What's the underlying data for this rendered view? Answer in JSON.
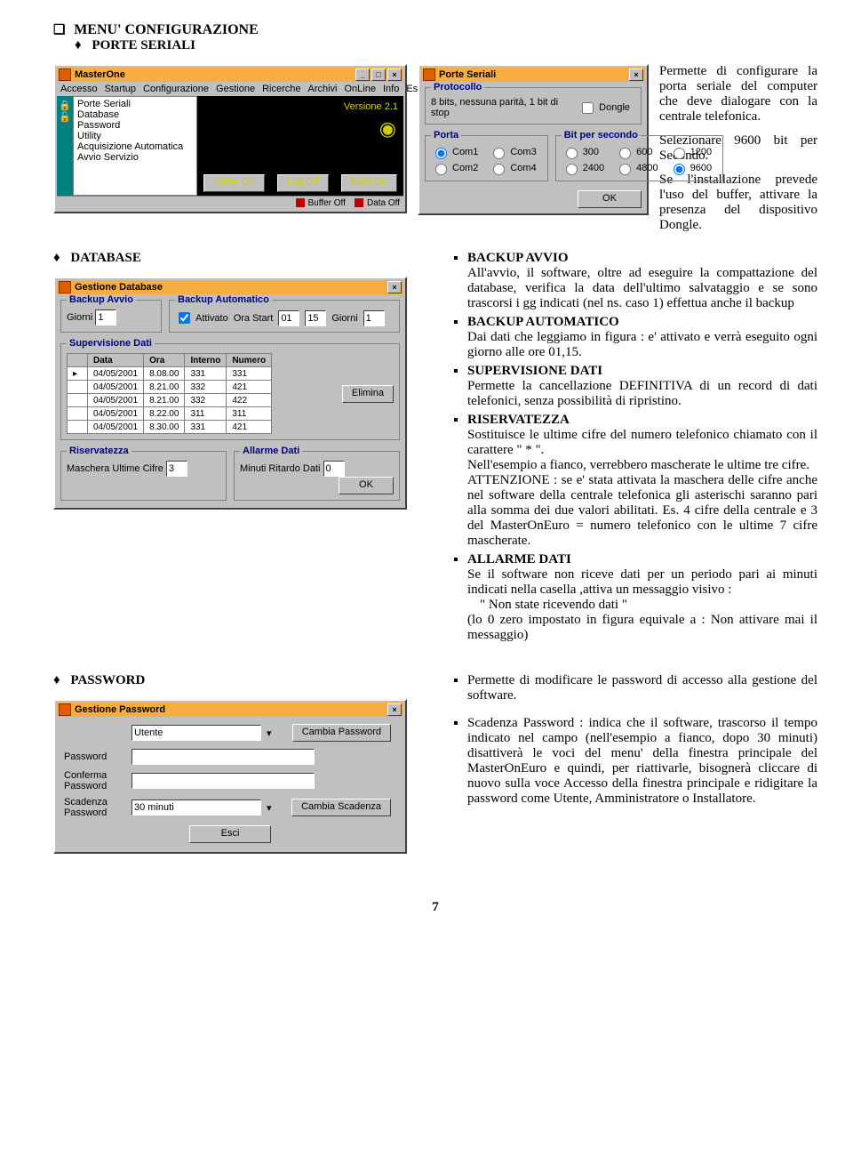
{
  "doc": {
    "h1": "MENU' CONFIGURAZIONE",
    "h2_porte": "PORTE SERIALI",
    "h2_database": "DATABASE",
    "h2_password": "PASSWORD",
    "page_number": "7"
  },
  "porte_paras": {
    "p1": "Permette di configurare la porta seriale del computer che deve dialogare con la centrale telefonica.",
    "p2": "Selezionare 9600 bit per Secondo.",
    "p3": "Se l'installazione prevede l'uso del buffer, attivare la presenza del dispositivo Dongle."
  },
  "db_items": {
    "i1_title": "BACKUP AVVIO",
    "i1_text": "All'avvio, il software, oltre ad eseguire la compattazione del database, verifica la data dell'ultimo salvataggio e se sono trascorsi i gg indicati (nel ns. caso 1) effettua anche il backup",
    "i2_title": "BACKUP AUTOMATICO",
    "i2_text": "Dai dati che leggiamo in figura : e' attivato e verrà eseguito ogni giorno alle ore 01,15.",
    "i3_title": "SUPERVISIONE DATI",
    "i3_text": "Permette la cancellazione DEFINITIVA di un record di dati telefonici, senza possibilità di ripristino.",
    "i4_title": "RISERVATEZZA",
    "i4_text1": "Sostituisce le ultime cifre del numero telefonico chiamato con il carattere \"  *  \".",
    "i4_text2": "Nell'esempio a fianco, verrebbero mascherate le ultime tre cifre.",
    "i4_text3": "ATTENZIONE : se e' stata attivata la maschera delle cifre anche nel software della centrale telefonica gli asterischi saranno pari alla somma dei due valori abilitati. Es. 4 cifre della centrale e 3 del MasterOnEuro = numero telefonico con le ultime 7 cifre mascherate.",
    "i5_title": "ALLARME DATI",
    "i5_text1": "Se il software non riceve dati per un periodo pari ai minuti indicati nella casella ,attiva un messaggio visivo :",
    "i5_text2": "\" Non state ricevendo dati  \"",
    "i5_text3": "(lo 0 zero impostato in figura equivale a :  Non attivare mai il messaggio)"
  },
  "pw_items": {
    "i1": "Permette di modificare le password di accesso alla gestione del software.",
    "i2": "Scadenza Password : indica che il software, trascorso il tempo indicato nel campo (nell'esempio a fianco, dopo 30 minuti) disattiverà le voci del menu' della finestra principale del MasterOnEuro e quindi, per riattivarle, bisognerà cliccare di nuovo sulla voce Accesso della finestra principale e ridigitare la password come Utente, Amministratore o Installatore."
  },
  "masterone": {
    "title": "MasterOne",
    "menubar": [
      "Accesso",
      "Startup",
      "Configurazione",
      "Gestione",
      "Ricerche",
      "Archivi",
      "OnLine",
      "Info",
      "Esci"
    ],
    "submenu": [
      "Porte Seriali",
      "Database",
      "Password",
      "Utility",
      "Acquisizione Automatica",
      "Avvio Servizio"
    ],
    "version": "Versione 2.1",
    "buttons": [
      "Buffer On",
      "Log Off",
      "Data On"
    ],
    "status": [
      "Buffer Off",
      "Data Off"
    ]
  },
  "porte": {
    "title": "Porte Seriali",
    "protocollo": {
      "legend": "Protocollo",
      "text": "8 bits, nessuna parità, 1 bit di stop",
      "dongle": "Dongle"
    },
    "porta": {
      "legend": "Porta",
      "options": [
        "Com1",
        "Com2",
        "Com3",
        "Com4"
      ]
    },
    "bit": {
      "legend": "Bit per secondo",
      "options": [
        "300",
        "600",
        "1200",
        "2400",
        "4800",
        "9600"
      ],
      "selected": "9600"
    },
    "ok": "OK"
  },
  "dbwin": {
    "title": "Gestione Database",
    "backup_avvio": {
      "legend": "Backup Avvio",
      "giorni_label": "Giorni",
      "giorni": "1"
    },
    "backup_auto": {
      "legend": "Backup Automatico",
      "attivato": "Attivato",
      "ora_label": "Ora Start",
      "ora_h": "01",
      "ora_m": "15",
      "giorni_label": "Giorni",
      "giorni": "1"
    },
    "supervisione": {
      "legend": "Supervisione Dati",
      "columns": [
        "Data",
        "Ora",
        "Interno",
        "Numero"
      ],
      "rows": [
        [
          "04/05/2001",
          "8.08.00",
          "331",
          "331"
        ],
        [
          "04/05/2001",
          "8.21.00",
          "332",
          "421"
        ],
        [
          "04/05/2001",
          "8.21.00",
          "332",
          "422"
        ],
        [
          "04/05/2001",
          "8.22.00",
          "311",
          "311"
        ],
        [
          "04/05/2001",
          "8.30.00",
          "331",
          "421"
        ]
      ],
      "elimina": "Elimina"
    },
    "riservatezza": {
      "legend": "Riservatezza",
      "label": "Maschera Ultime Cifre",
      "value": "3"
    },
    "allarme": {
      "legend": "Allarme Dati",
      "label": "Minuti Ritardo Dati",
      "value": "0"
    },
    "ok": "OK"
  },
  "pwwin": {
    "title": "Gestione Password",
    "utente": "Utente",
    "cambia_pw": "Cambia Password",
    "lbl_pw": "Password",
    "lbl_conferma": "Conferma\nPassword",
    "lbl_scadenza": "Scadenza\nPassword",
    "scadenza_val": "30 minuti",
    "cambia_scad": "Cambia Scadenza",
    "esci": "Esci"
  }
}
